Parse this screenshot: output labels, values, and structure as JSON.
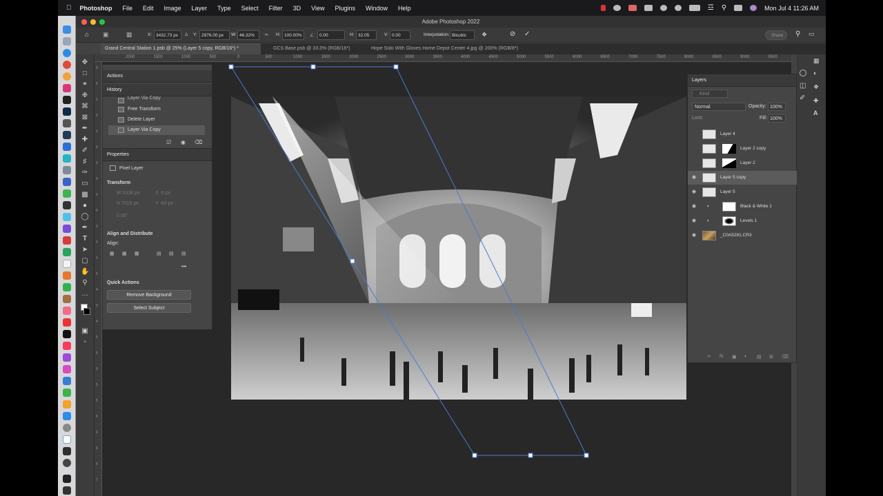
{
  "menubar": {
    "app": "Photoshop",
    "menus": [
      "File",
      "Edit",
      "Image",
      "Layer",
      "Type",
      "Select",
      "Filter",
      "3D",
      "View",
      "Plugins",
      "Window",
      "Help"
    ],
    "clock": "Mon Jul 4  11:26 AM"
  },
  "window": {
    "title": "Adobe Photoshop 2022"
  },
  "options": {
    "x_label": "X:",
    "x_value": "3432.73 px",
    "y_label": "Y:",
    "y_value": "2976.00 px",
    "w_label": "W:",
    "w_value": "46.32%",
    "h_label": "H:",
    "h_value": "100.00%",
    "angle_value": "0.00",
    "hskew_label": "H:",
    "hskew_value": "32.05",
    "vskew_label": "V:",
    "vskew_value": "0.00",
    "interp_label": "Interpolation:",
    "interp_value": "Bicubic",
    "share": "Share"
  },
  "tabs": [
    {
      "label": "Grand Central Station 1.psb @ 25% (Layer 5 copy, RGB/16*) *"
    },
    {
      "label": "GCS Base.psb @ 33.3% (RGB/16*)"
    },
    {
      "label": "Hope Solo With Gloves Home Depot Center 4.jpg @ 200% (RGB/8*)"
    }
  ],
  "ruler_top": [
    "2000",
    "1500",
    "1000",
    "500",
    "0",
    "500",
    "1000",
    "1500",
    "2000",
    "2500",
    "3000",
    "3500",
    "4000",
    "4500",
    "5000",
    "5500",
    "6000",
    "6500",
    "7000",
    "7500",
    "8000",
    "8500",
    "9000",
    "9500"
  ],
  "ruler_left": [
    "0",
    "5",
    "1",
    "0",
    "1",
    "5",
    "2",
    "0",
    "2",
    "5",
    "3",
    "0",
    "3",
    "5",
    "4",
    "0",
    "4",
    "5",
    "5",
    "0",
    "5",
    "5",
    "6",
    "0",
    "6",
    "5",
    "7"
  ],
  "actions_panel": {
    "title": "Actions"
  },
  "history_panel": {
    "title": "History",
    "items": [
      "Layer Via Copy",
      "Free Transform",
      "Delete Layer",
      "Layer Via Copy"
    ]
  },
  "properties_panel": {
    "title": "Properties",
    "kind": "Pixel Layer",
    "transform_title": "Transform",
    "w_field": "W  5338 px",
    "x_field": "X  -5 px",
    "h_field": "H  7016 px",
    "y_field": "Y  -63 px",
    "angle_field": "0.00°",
    "align_title": "Align and Distribute",
    "align_label": "Align:",
    "more": "•••",
    "quick_title": "Quick Actions",
    "btn_remove_bg": "Remove Background",
    "btn_select_subject": "Select Subject"
  },
  "layers_panel": {
    "title": "Layers",
    "filter_placeholder": "Kind",
    "blend_mode": "Normal",
    "opacity_label": "Opacity:",
    "opacity_value": "100%",
    "lock_label": "Lock:",
    "fill_label": "Fill:",
    "fill_value": "100%",
    "layers": [
      {
        "name": "Layer 4",
        "visible": false,
        "mask": false
      },
      {
        "name": "Layer 2 copy",
        "visible": false,
        "mask": true
      },
      {
        "name": "Layer 2",
        "visible": false,
        "mask": true
      },
      {
        "name": "Layer 5 copy",
        "visible": true,
        "mask": false,
        "selected": true
      },
      {
        "name": "Layer 5",
        "visible": true,
        "mask": false
      },
      {
        "name": "Black & White 1",
        "visible": true,
        "mask": true,
        "adjustment": true
      },
      {
        "name": "Levels 1",
        "visible": true,
        "mask": true,
        "adjustment": true
      },
      {
        "name": "_C0A5281.CR3",
        "visible": true,
        "mask": false,
        "photo": true
      }
    ]
  },
  "colors": {
    "accent_selection": "#4a7bd1",
    "panel_bg": "#454545",
    "canvas_bg": "#282828"
  }
}
